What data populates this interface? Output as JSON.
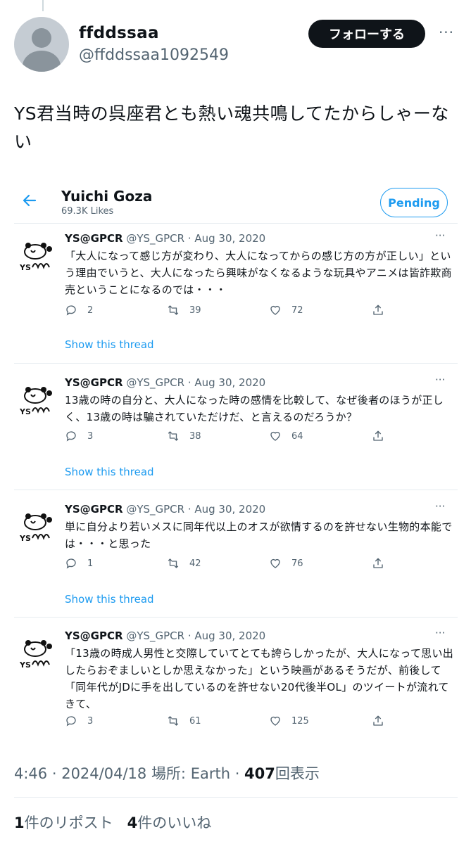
{
  "tweet": {
    "display_name": "ffddssaa",
    "handle": "@ffddssaa1092549",
    "follow_label": "フォローする",
    "more": "···",
    "text": "YS君当時の呉座君とも熱い魂共鳴してたからしゃーない",
    "time": "4:46",
    "date": "2024/04/18",
    "place": "場所: Earth",
    "views_count": "407",
    "views_label": "回表示",
    "reposts_count": "1",
    "reposts_label": "件のリポスト",
    "likes_count": "4",
    "likes_label": "件のいいね"
  },
  "embed": {
    "profile_name": "Yuichi Goza",
    "profile_likes": "69.3K Likes",
    "pending_label": "Pending",
    "show_thread": "Show this thread",
    "tweets": [
      {
        "name": "YS@GPCR",
        "meta": "@YS_GPCR · Aug 30, 2020",
        "text": "「大人になって感じ方が変わり、大人になってからの感じ方の方が正しい」という理由でいうと、大人になったら興味がなくなるような玩具やアニメは皆詐欺商売ということになるのでは・・・",
        "replies": "2",
        "retweets": "39",
        "likes": "72"
      },
      {
        "name": "YS@GPCR",
        "meta": "@YS_GPCR · Aug 30, 2020",
        "text": "13歳の時の自分と、大人になった時の感情を比較して、なぜ後者のほうが正しく、13歳の時は騙されていただけだ、と言えるのだろうか？",
        "replies": "3",
        "retweets": "38",
        "likes": "64"
      },
      {
        "name": "YS@GPCR",
        "meta": "@YS_GPCR · Aug 30, 2020",
        "text": "単に自分より若いメスに同年代以上のオスが欲情するのを許せない生物的本能では・・・と思った",
        "replies": "1",
        "retweets": "42",
        "likes": "76"
      },
      {
        "name": "YS@GPCR",
        "meta": "@YS_GPCR · Aug 30, 2020",
        "text": "「13歳の時成人男性と交際していてとても誇らしかったが、大人になって思い出したらおぞましいとしか思えなかった」という映画があるそうだが、前後して「同年代がJDに手を出しているのを許せない20代後半OL」のツイートが流れてきて、",
        "replies": "3",
        "retweets": "61",
        "likes": "125"
      }
    ]
  },
  "colors": {
    "accent": "#1d9bf0",
    "text": "#0f1419",
    "secondary": "#536471",
    "follow_bg": "#0f1419"
  },
  "icons": [
    "default-avatar-icon",
    "more-icon",
    "back-arrow-icon",
    "ys-avatar-icon",
    "reply-icon",
    "retweet-icon",
    "like-icon",
    "share-icon"
  ]
}
